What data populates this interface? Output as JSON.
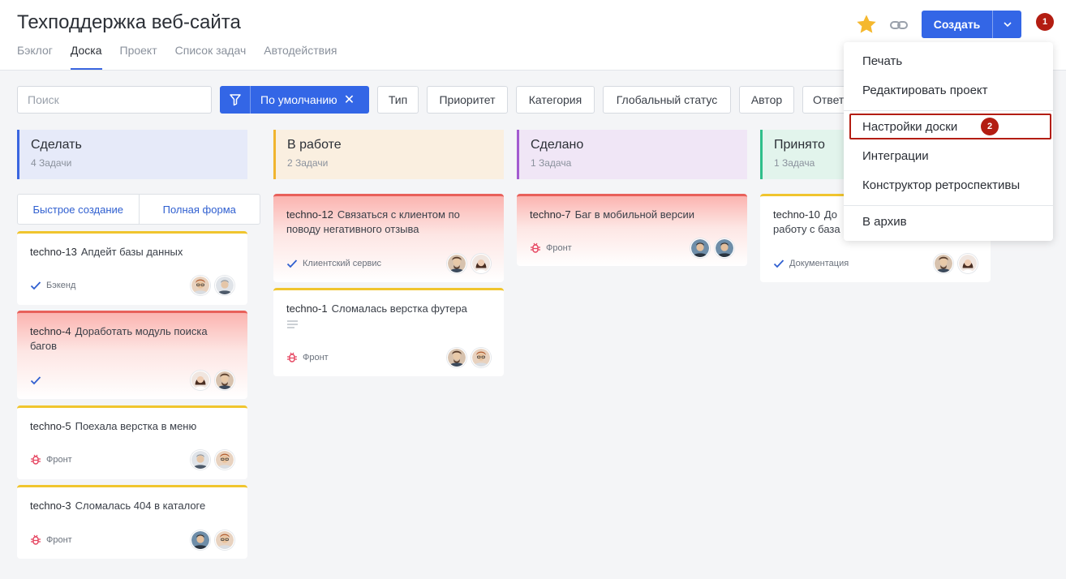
{
  "app": {
    "title": "Техподдержка веб-сайта",
    "tabs": [
      {
        "label": "Бэклог"
      },
      {
        "label": "Доска"
      },
      {
        "label": "Проект"
      },
      {
        "label": "Список задач"
      },
      {
        "label": "Автодействия"
      }
    ],
    "active_tab": "Доска",
    "create_label": "Создать"
  },
  "markers": [
    "1",
    "2"
  ],
  "filters": {
    "search_placeholder": "Поиск",
    "default_label": "По умолчанию",
    "buttons": [
      "Тип",
      "Приоритет",
      "Категория",
      "Глобальный статус",
      "Автор",
      "Ответ"
    ]
  },
  "columns": [
    {
      "title": "Сделать",
      "count": "4 Задачи",
      "color": "#3a66e0"
    },
    {
      "title": "В работе",
      "count": "2 Задачи",
      "color": "#f0b42e"
    },
    {
      "title": "Сделано",
      "count": "1 Задача",
      "color": "#a35bd0"
    },
    {
      "title": "Принято",
      "count": "1 Задача",
      "color": "#2fbf8a"
    }
  ],
  "quick_create": {
    "quick": "Быстрое создание",
    "full": "Полная форма"
  },
  "cards": [
    {
      "key": "techno-13",
      "title": "Апдейт базы данных",
      "tag": "Бэкенд",
      "tag_icon": "check-icon"
    },
    {
      "key": "techno-4",
      "title": "Доработать модуль поиска багов",
      "tag": "",
      "tag_icon": "check-icon"
    },
    {
      "key": "techno-5",
      "title": "Поехала верстка в меню",
      "tag": "Фронт",
      "tag_icon": "bug-icon"
    },
    {
      "key": "techno-3",
      "title": "Сломалась 404 в каталоге",
      "tag": "Фронт",
      "tag_icon": "bug-icon"
    },
    {
      "key": "techno-12",
      "title": "Связаться с клиентом по поводу негативного отзыва",
      "tag": "Клиентский сервис",
      "tag_icon": "check-icon"
    },
    {
      "key": "techno-1",
      "title": "Сломалась верстка футера",
      "tag": "Фронт",
      "tag_icon": "bug-icon"
    },
    {
      "key": "techno-7",
      "title": "Баг в мобильной версии",
      "tag": "Фронт",
      "tag_icon": "bug-icon"
    },
    {
      "key": "techno-10",
      "title": "До работу с база",
      "tag": "Документация",
      "tag_icon": "check-icon"
    }
  ],
  "menu": [
    "Печать",
    "Редактировать проект",
    "Настройки доски",
    "Интеграции",
    "Конструктор ретроспективы",
    "В архив"
  ],
  "colors": {
    "accent": "#3366e6",
    "marker": "#b31d12",
    "urgent": "#e8605a",
    "normal": "#f0c52e"
  }
}
